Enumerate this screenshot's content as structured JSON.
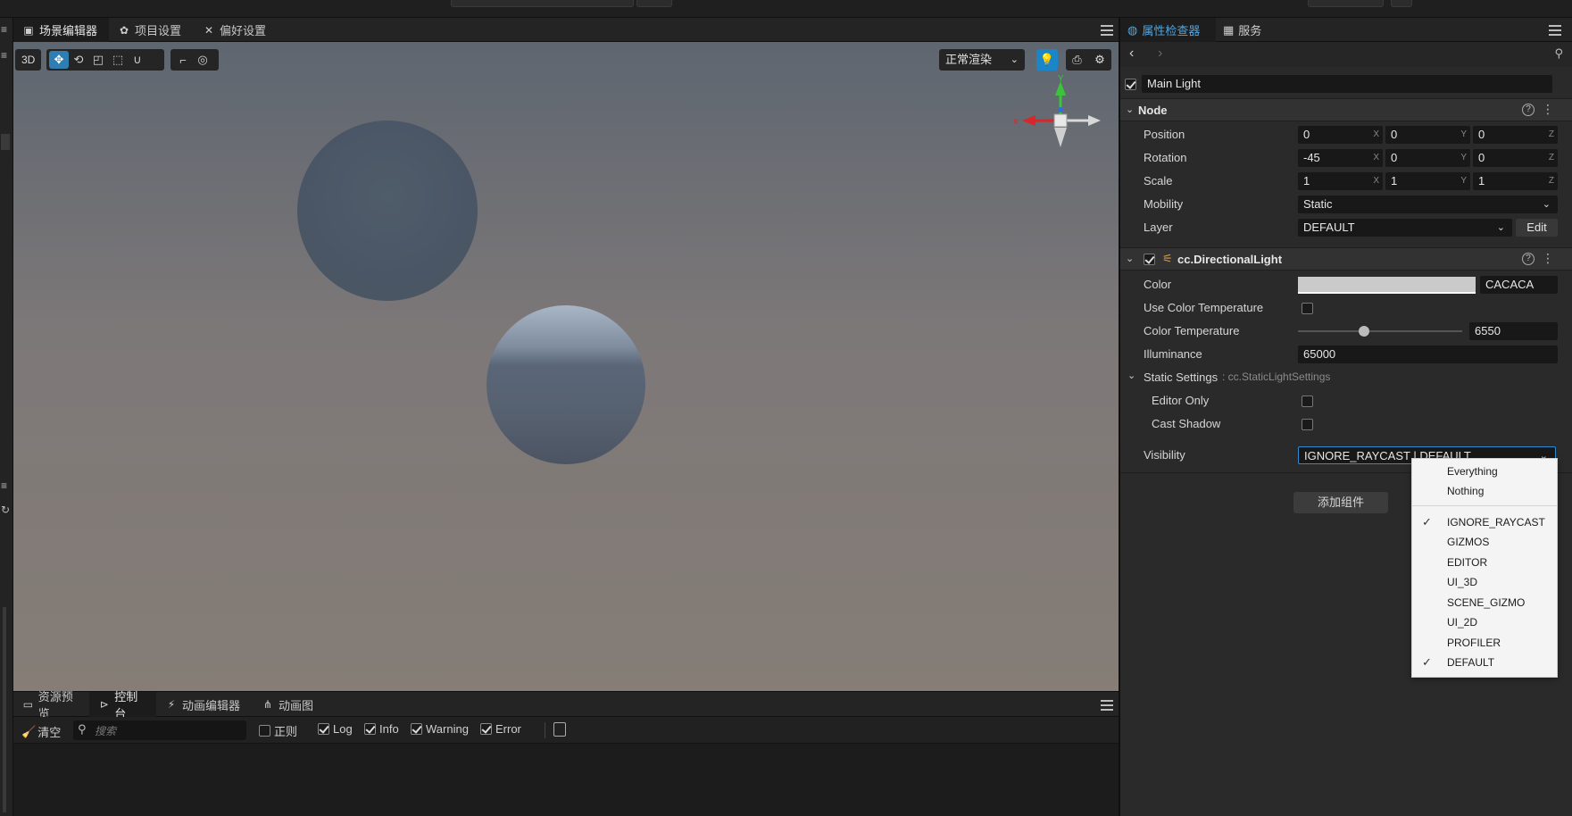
{
  "scene_tabs": [
    {
      "label": "场景编辑器",
      "icon": "scene-icon"
    },
    {
      "label": "项目设置",
      "icon": "gear-icon"
    },
    {
      "label": "偏好设置",
      "icon": "tools-icon"
    }
  ],
  "viewport": {
    "mode_3d": "3D",
    "render_mode": "正常渲染"
  },
  "gizmo": {
    "x_label": "x",
    "y_label": "Y"
  },
  "console": {
    "tabs": [
      {
        "label": "资源预览",
        "icon": "image-icon"
      },
      {
        "label": "控制台",
        "icon": "terminal-icon"
      },
      {
        "label": "动画编辑器",
        "icon": "run-icon"
      },
      {
        "label": "动画图",
        "icon": "graph-icon"
      }
    ],
    "clear_label": "清空",
    "search_placeholder": "搜索",
    "filters": [
      {
        "label": "正则",
        "checked": false
      },
      {
        "label": "Log",
        "checked": true
      },
      {
        "label": "Info",
        "checked": true
      },
      {
        "label": "Warning",
        "checked": true
      },
      {
        "label": "Error",
        "checked": true
      }
    ]
  },
  "inspector": {
    "tabs": [
      {
        "label": "属性检查器",
        "icon": "globe-icon"
      },
      {
        "label": "服务",
        "icon": "grid-icon"
      }
    ],
    "node_name": "Main Light",
    "node_enabled": true,
    "node_section": {
      "title": "Node",
      "position": {
        "label": "Position",
        "x": "0",
        "y": "0",
        "z": "0"
      },
      "rotation": {
        "label": "Rotation",
        "x": "-45",
        "y": "0",
        "z": "0"
      },
      "scale": {
        "label": "Scale",
        "x": "1",
        "y": "1",
        "z": "1"
      },
      "mobility": {
        "label": "Mobility",
        "value": "Static"
      },
      "layer": {
        "label": "Layer",
        "value": "DEFAULT",
        "edit": "Edit"
      },
      "axis_x": "X",
      "axis_y": "Y",
      "axis_z": "Z"
    },
    "light_section": {
      "title": "cc.DirectionalLight",
      "enabled": true,
      "color_label": "Color",
      "color_hex": "CACACA",
      "color_swatch": "#cacaca",
      "use_temp_label": "Use Color Temperature",
      "use_temp_checked": false,
      "temp_label": "Color Temperature",
      "temp_value": "6550",
      "temp_slider_fraction": 0.4,
      "illuminance_label": "Illuminance",
      "illuminance_value": "65000",
      "static_settings_label": "Static Settings",
      "static_settings_type": ": cc.StaticLightSettings",
      "editor_only_label": "Editor Only",
      "cast_shadow_label": "Cast Shadow",
      "visibility_label": "Visibility",
      "visibility_value": "IGNORE_RAYCAST | DEFAULT"
    },
    "add_component": "添加组件"
  },
  "visibility_menu": {
    "top_items": [
      "Everything",
      "Nothing"
    ],
    "items": [
      {
        "label": "IGNORE_RAYCAST",
        "checked": true
      },
      {
        "label": "GIZMOS",
        "checked": false
      },
      {
        "label": "EDITOR",
        "checked": false
      },
      {
        "label": "UI_3D",
        "checked": false
      },
      {
        "label": "SCENE_GIZMO",
        "checked": false
      },
      {
        "label": "UI_2D",
        "checked": false
      },
      {
        "label": "PROFILER",
        "checked": false
      },
      {
        "label": "DEFAULT",
        "checked": true
      }
    ]
  },
  "colors": {
    "accent": "#2e7db3",
    "inspector_tab_active": "#4fa6e0",
    "gizmo_x": "#d9262b",
    "gizmo_y": "#3bc43b",
    "gizmo_z": "#2e6fd9"
  }
}
